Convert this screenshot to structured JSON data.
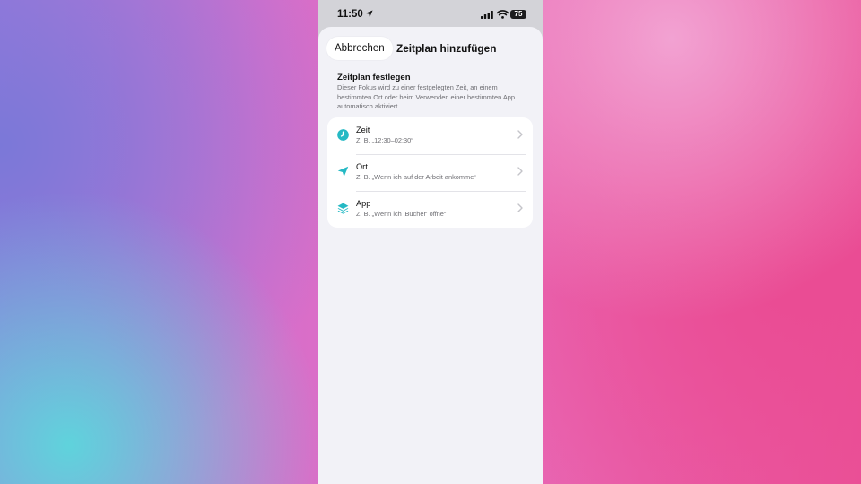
{
  "status_bar": {
    "time": "11:50",
    "battery": "75"
  },
  "sheet": {
    "cancel_label": "Abbrechen",
    "title": "Zeitplan hinzufügen",
    "section_title": "Zeitplan festlegen",
    "section_description": "Dieser Fokus wird zu einer festgelegten Zeit, an einem bestimmten Ort oder beim Verwenden einer bestimmten App automatisch aktiviert."
  },
  "options": [
    {
      "title": "Zeit",
      "subtitle": "Z. B. „12:30–02:30“",
      "icon": "clock-icon"
    },
    {
      "title": "Ort",
      "subtitle": "Z. B. „Wenn ich auf der Arbeit ankomme“",
      "icon": "location-arrow-icon"
    },
    {
      "title": "App",
      "subtitle": "Z. B. „Wenn ich ‚Bücher‘ öffne“",
      "icon": "app-stack-icon"
    }
  ],
  "colors": {
    "accent": "#25b9c4",
    "sheet_bg": "#f2f2f7",
    "card_bg": "#ffffff"
  }
}
